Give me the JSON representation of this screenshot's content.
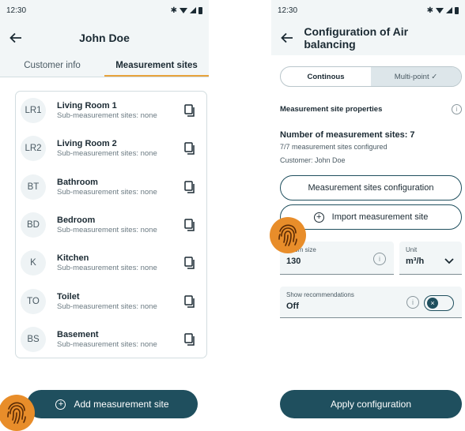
{
  "left": {
    "status": {
      "time": "12:30",
      "bluetooth": "✱"
    },
    "header": {
      "title": "John Doe"
    },
    "tabs": [
      {
        "label": "Customer info"
      },
      {
        "label": "Measurement sites"
      }
    ],
    "sites": [
      {
        "abbr": "LR1",
        "name": "Living Room 1",
        "sub": "Sub-measurement sites: none"
      },
      {
        "abbr": "LR2",
        "name": "Living Room 2",
        "sub": "Sub-measurement sites: none"
      },
      {
        "abbr": "BT",
        "name": "Bathroom",
        "sub": "Sub-measurement sites: none"
      },
      {
        "abbr": "BD",
        "name": "Bedroom",
        "sub": "Sub-measurement sites: none"
      },
      {
        "abbr": "K",
        "name": "Kitchen",
        "sub": "Sub-measurement sites: none"
      },
      {
        "abbr": "TO",
        "name": "Toilet",
        "sub": "Sub-measurement sites: none"
      },
      {
        "abbr": "BS",
        "name": "Basement",
        "sub": "Sub-measurement sites: none"
      }
    ],
    "add_button": {
      "label": "Add measurement site",
      "icon": "plus-circle-icon"
    }
  },
  "right": {
    "status": {
      "time": "12:30",
      "bluetooth": "✱"
    },
    "header": {
      "title": "Configuration of Air balancing"
    },
    "mode": {
      "options": [
        "Continous",
        "Multi-point ✓"
      ],
      "selected": 1
    },
    "section": {
      "title": "Measurement site properties",
      "info": "i"
    },
    "summary": {
      "count": "Number of measurement sites: 7",
      "configured": "7/7 measurement sites configured",
      "customer": "Customer: John Doe"
    },
    "buttons": {
      "configure": "Measurement sites configuration",
      "import": "Import measurement site",
      "apply": "Apply configuration"
    },
    "size_field": {
      "label": "Room size",
      "value": "130"
    },
    "unit_field": {
      "label": "Unit",
      "value": "m³/h"
    },
    "recommend_field": {
      "label": "Show recommendations",
      "value": "Off",
      "toggle_icon": "×"
    }
  },
  "colors": {
    "primary": "#1f4f5e",
    "accent": "#e8a33c",
    "surface": "#f2f6f7",
    "fingerprint": "#e88d2a"
  }
}
